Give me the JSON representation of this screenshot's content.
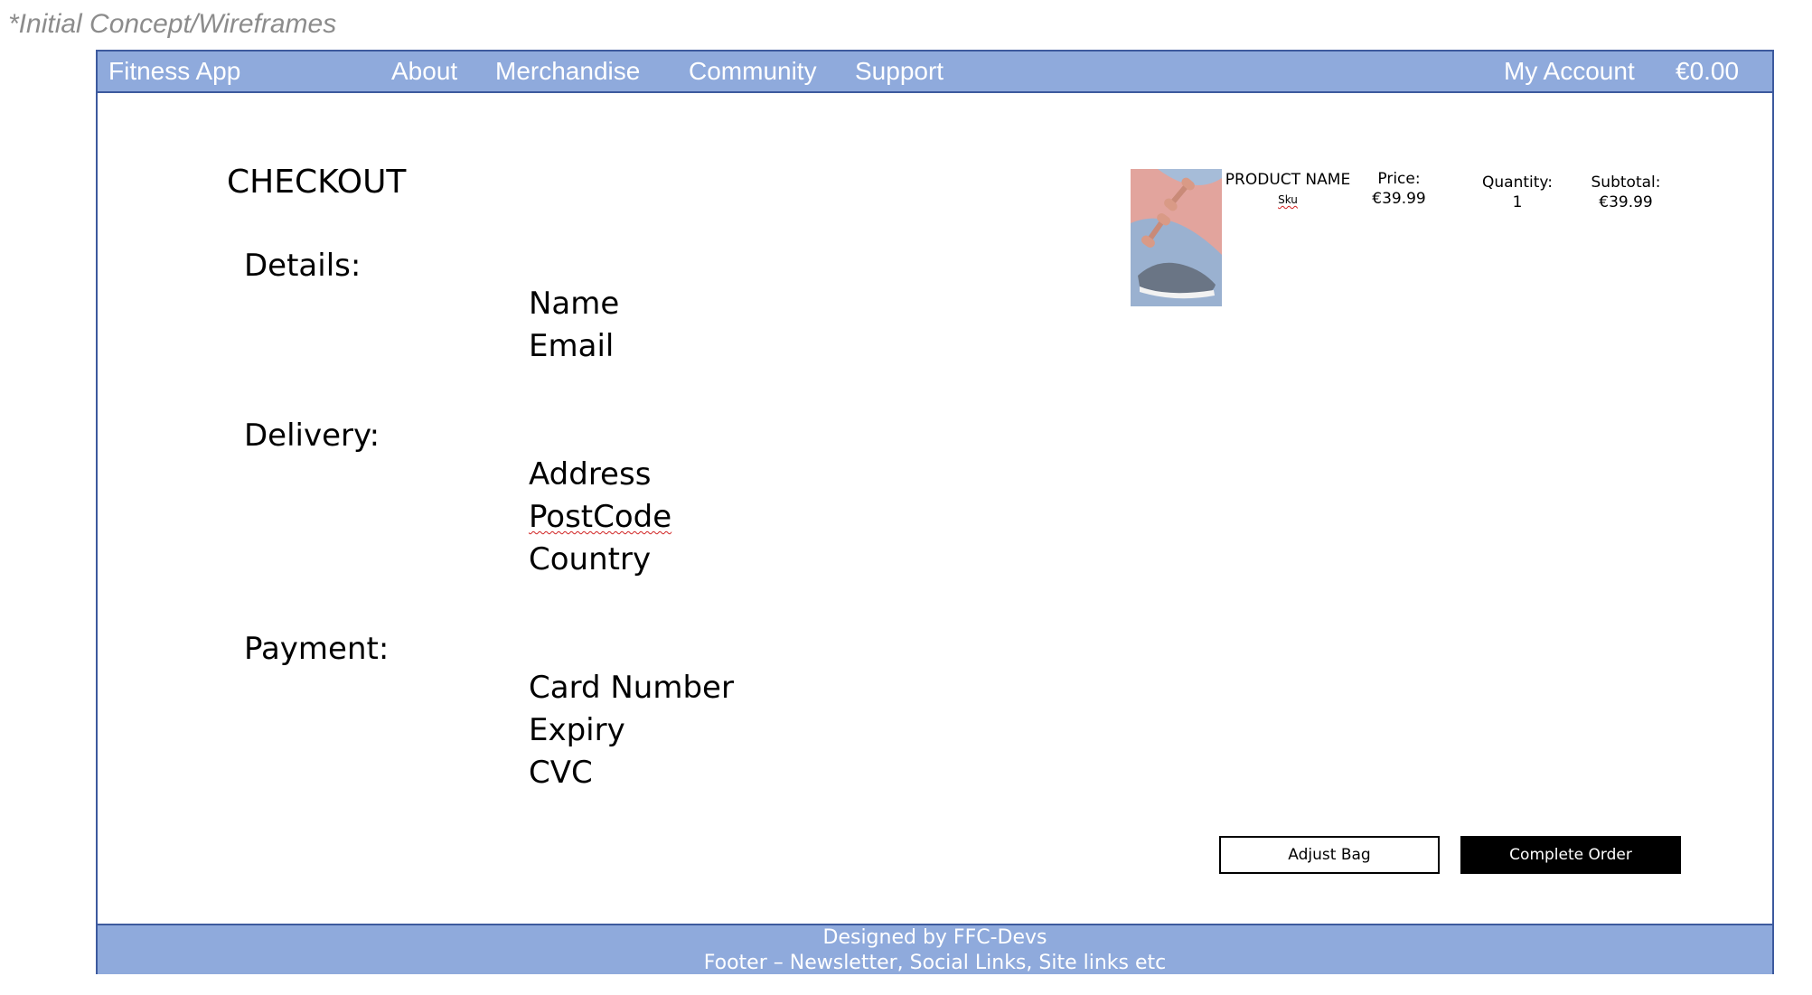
{
  "caption": "*Initial Concept/Wireframes",
  "nav": {
    "brand": "Fitness App",
    "links": [
      "About",
      "Merchandise",
      "Community",
      "Support"
    ],
    "account": "My Account",
    "cart_total": "€0.00"
  },
  "checkout": {
    "title": "CHECKOUT",
    "sections": [
      {
        "heading": "Details:",
        "fields": [
          "Name",
          "Email"
        ]
      },
      {
        "heading": "Delivery:",
        "fields": [
          "Address",
          "PostCode",
          "Country"
        ]
      },
      {
        "heading": "Payment:",
        "fields": [
          "Card Number",
          "Expiry",
          "CVC"
        ]
      }
    ]
  },
  "product": {
    "name": "PRODUCT NAME",
    "sku": "Sku",
    "price_label": "Price:",
    "price_value": "€39.99",
    "quantity_label": "Quantity:",
    "quantity_value": "1",
    "subtotal_label": "Subtotal:",
    "subtotal_value": "€39.99"
  },
  "buttons": {
    "adjust_bag": "Adjust Bag",
    "complete_order": "Complete Order"
  },
  "footer": {
    "line1": "Designed by FFC-Devs",
    "line2": "Footer – Newsletter, Social Links, Site links etc"
  },
  "colors": {
    "nav_bg": "#8faadc",
    "nav_border": "#3d5a9e",
    "caption": "#8c8c8c"
  },
  "icons": {
    "product_image": "dumbbells-and-sneaker-image"
  }
}
